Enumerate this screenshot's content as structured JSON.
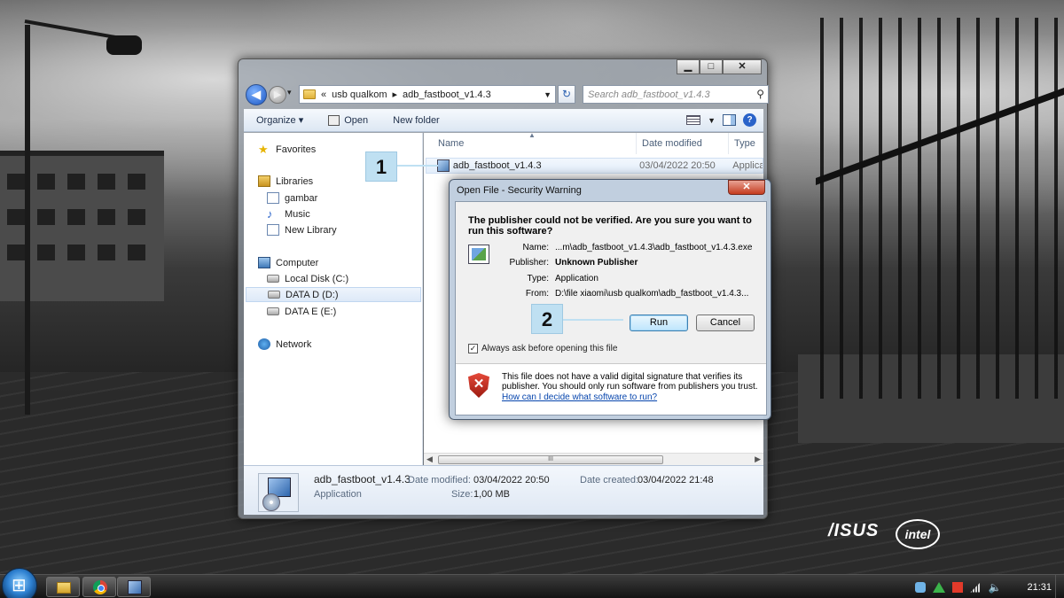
{
  "window": {
    "controls": {
      "minimize": "▁",
      "maximize": "□",
      "close": "✕"
    },
    "breadcrumb": {
      "prefix": "«",
      "parent": "usb qualkom",
      "separator": "▸",
      "current": "adb_fastboot_v1.4.3"
    },
    "search_placeholder": "Search adb_fastboot_v1.4.3"
  },
  "toolbar": {
    "organize_label": "Organize ▾",
    "open_label": "Open",
    "new_folder_label": "New folder"
  },
  "sidebar": {
    "favorites": "Favorites",
    "libraries": "Libraries",
    "library_items": [
      "gambar",
      "Music",
      "New Library"
    ],
    "computer": "Computer",
    "drives": [
      "Local Disk (C:)",
      "DATA D (D:)",
      "DATA E (E:)"
    ],
    "network": "Network"
  },
  "file_list": {
    "columns": [
      "Name",
      "Date modified",
      "Type"
    ],
    "rows": [
      {
        "name": "adb_fastboot_v1.4.3",
        "date": "03/04/2022 20:50",
        "type": "Applica"
      }
    ],
    "scroll_grip": "III"
  },
  "details_pane": {
    "file_name": "adb_fastboot_v1.4.3",
    "file_type": "Application",
    "date_modified_label": "Date modified:",
    "date_modified": "03/04/2022 20:50",
    "size_label": "Size:",
    "size": "1,00 MB",
    "date_created_label": "Date created:",
    "date_created": "03/04/2022 21:48"
  },
  "markers": {
    "step1": "1",
    "step2": "2"
  },
  "dialog": {
    "title": "Open File - Security Warning",
    "close": "✕",
    "question": "The publisher could not be verified.  Are you sure you want to run this software?",
    "fields": [
      {
        "key": "Name:",
        "value": "...m\\adb_fastboot_v1.4.3\\adb_fastboot_v1.4.3.exe"
      },
      {
        "key": "Publisher:",
        "value": "Unknown Publisher"
      },
      {
        "key": "Type:",
        "value": "Application"
      },
      {
        "key": "From:",
        "value": "D:\\file xiaomi\\usb qualkom\\adb_fastboot_v1.4.3..."
      }
    ],
    "run_label": "Run",
    "cancel_label": "Cancel",
    "always_ask_label": "Always ask before opening this file",
    "always_ask_checked": true,
    "warning_text": "This file does not have a valid digital signature that verifies its publisher.  You should only run software from publishers you trust.",
    "help_link": "How can I decide what software to run?"
  },
  "branding": {
    "asus": "/ISUS",
    "intel": "intel"
  },
  "taskbar": {
    "clock": "21:31"
  },
  "colors": {
    "accent": "#2a63c9",
    "marker": "#bfe0f2",
    "warning_red": "#c53c1f"
  }
}
